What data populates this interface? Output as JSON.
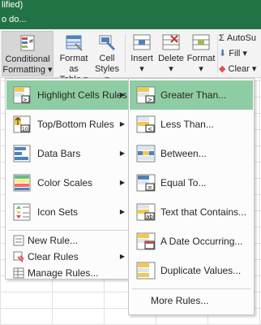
{
  "window": {
    "title_fragment": "lified)",
    "tell_me": "o do..."
  },
  "ribbon": {
    "conditional_formatting": {
      "line1": "Conditional",
      "line2": "Formatting ▾"
    },
    "format_as_table": {
      "line1": "Format as",
      "line2": "Table ▾"
    },
    "cell_styles": {
      "line1": "Cell",
      "line2": "Styles ▾"
    },
    "insert": {
      "line1": "Insert",
      "line2": "▾"
    },
    "delete": {
      "line1": "Delete",
      "line2": "▾"
    },
    "format": {
      "line1": "Format",
      "line2": "▾"
    },
    "autosum": "AutoSu",
    "fill": "Fill ▾",
    "clear": "Clear ▾"
  },
  "menu": {
    "items": [
      {
        "label": "Highlight Cells Rules",
        "has_submenu": true
      },
      {
        "label": "Top/Bottom Rules",
        "has_submenu": true
      },
      {
        "label": "Data Bars",
        "has_submenu": true
      },
      {
        "label": "Color Scales",
        "has_submenu": true
      },
      {
        "label": "Icon Sets",
        "has_submenu": true
      }
    ],
    "small_items": [
      {
        "label": "New Rule..."
      },
      {
        "label": "Clear Rules",
        "has_submenu": true
      },
      {
        "label": "Manage Rules..."
      }
    ]
  },
  "submenu": {
    "items": [
      {
        "label": "Greater Than..."
      },
      {
        "label": "Less Than..."
      },
      {
        "label": "Between..."
      },
      {
        "label": "Equal To..."
      },
      {
        "label": "Text that Contains..."
      },
      {
        "label": "A Date Occurring..."
      },
      {
        "label": "Duplicate Values..."
      }
    ],
    "more": "More Rules..."
  },
  "colors": {
    "excel_green": "#217346",
    "highlight": "#8ecda3"
  }
}
